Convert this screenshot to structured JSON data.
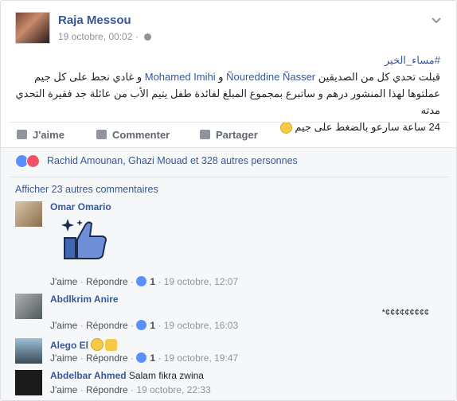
{
  "post": {
    "author": "Raja Messou",
    "timestamp": "19 octobre, 00:02 · ",
    "hashtag": "#مساء_الخير",
    "line1_pre": "قبلت تحدي كل من الصديقين ",
    "mention1": "Ñoureddine Ñasser",
    "line1_mid": " و ",
    "mention2": "Mohamed Imihi",
    "line1_post": " و غادي نحط على كل جيم",
    "line2": "عملتوها لهذا المنشور درهم و ساتبرع بمجموع المبلغ لفائدة طفل يتيم الأب من عائلة جد فقيرة التحدي مدته",
    "line3": "24 ساعة سارعو بالضغط على جيم"
  },
  "actions": {
    "like": "J'aime",
    "comment": "Commenter",
    "share": "Partager"
  },
  "reactions": {
    "text": "Rachid Amounan, Ghazi Mouad et 328 autres personnes"
  },
  "more_comments": "Afficher 23 autres commentaires",
  "comments": [
    {
      "name": "Omar Omario",
      "text": "",
      "like": "J'aime",
      "reply": "Répondre",
      "count": "1",
      "time": "19 octobre, 12:07"
    },
    {
      "name": "Abdlkrim Anire",
      "text": "",
      "side_text": "*¢¢¢¢¢¢¢¢¢",
      "like": "J'aime",
      "reply": "Répondre",
      "count": "1",
      "time": "19 octobre, 16:03"
    },
    {
      "name": "Alego El",
      "text": "",
      "like": "J'aime",
      "reply": "Répondre",
      "count": "1",
      "time": "19 octobre, 19:47"
    },
    {
      "name": "Abdelbar Ahmed",
      "text": "Salam fikra zwina",
      "like": "J'aime",
      "reply": "Répondre",
      "time": "19 octobre, 22:33"
    }
  ],
  "separator": " · ",
  "colors": {
    "link": "#365899",
    "like_blue": "#5890ff",
    "love_red": "#f25268",
    "muted": "#90949c"
  }
}
